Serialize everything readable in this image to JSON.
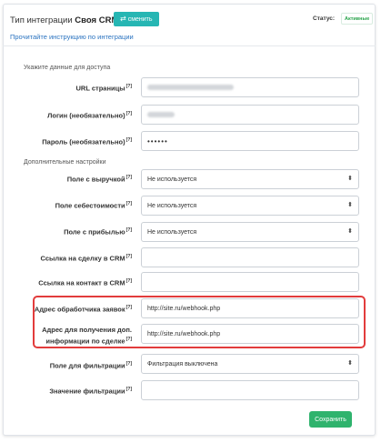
{
  "header": {
    "title_prefix": "Тип интеграции",
    "title_value": "Своя CRM",
    "change_label": "сменить",
    "change_icon": "swap-arrows-icon",
    "status_label": "Статус:",
    "status_value": "Активные",
    "status_color": "#27a34a",
    "instructions_link": "Прочитайте инструкцию по интеграции"
  },
  "sections": {
    "access": "Укажите данные для доступа",
    "additional": "Дополнительные настройки"
  },
  "fields": {
    "url": {
      "label": "URL страницы",
      "hint": "[?]"
    },
    "login": {
      "label": "Логин (необязательно)",
      "hint": "[?]"
    },
    "password": {
      "label": "Пароль (необязательно)",
      "hint": "[?]",
      "value": "••••••"
    },
    "revenue": {
      "label": "Поле с выручкой",
      "hint": "[?]",
      "value": "Не используется"
    },
    "cost": {
      "label": "Поле себестоимости",
      "hint": "[?]",
      "value": "Не используется"
    },
    "profit": {
      "label": "Поле с прибылью",
      "hint": "[?]",
      "value": "Не используется"
    },
    "deal_link": {
      "label": "Ссылка на сделку в CRM",
      "hint": "[?]",
      "value": ""
    },
    "contact_link": {
      "label": "Ссылка на контакт в CRM",
      "hint": "[?]",
      "value": ""
    },
    "handler": {
      "label": "Адрес обработчика заявок",
      "hint": "[?]",
      "value": "http://site.ru/webhook.php"
    },
    "deal_info": {
      "label_line1": "Адрес для получения доп.",
      "label_line2": "информации по сделке",
      "hint": "[?]",
      "value": "http://site.ru/webhook.php"
    },
    "filter_field": {
      "label": "Поле для фильтрации",
      "hint": "[?]",
      "value": "Фильтрация выключена"
    },
    "filter_value": {
      "label": "Значение фильтрации",
      "hint": "[?]",
      "value": ""
    }
  },
  "actions": {
    "save_label": "Сохранить",
    "save_color": "#2fb36d"
  },
  "accent": {
    "brand": "#26b6b3",
    "highlight": "#e23c3c",
    "link": "#2a73c0"
  }
}
